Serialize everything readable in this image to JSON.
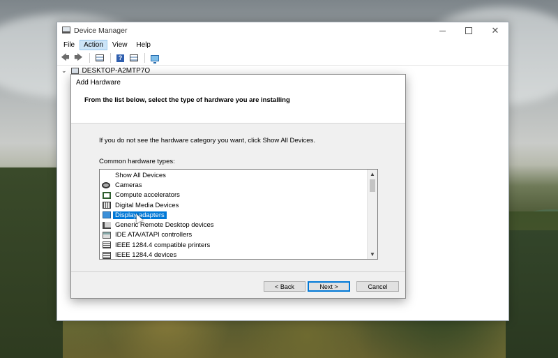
{
  "window": {
    "title": "Device Manager",
    "controls": {
      "minimize": "—",
      "maximize": "☐",
      "close": "✕"
    }
  },
  "menubar": {
    "items": [
      {
        "label": "File"
      },
      {
        "label": "Action",
        "active": true
      },
      {
        "label": "View"
      },
      {
        "label": "Help"
      }
    ]
  },
  "toolbar": {
    "buttons": [
      "back-arrow-icon",
      "forward-arrow-icon",
      "properties-icon",
      "help-icon",
      "grid-view-icon",
      "monitor-scan-icon"
    ]
  },
  "tree": {
    "root_label": "DESKTOP-A2MTP7O",
    "expand_glyph": "⌄"
  },
  "dialog": {
    "title": "Add Hardware",
    "heading": "From the list below, select the type of hardware you are installing",
    "info": "If you do not see the hardware category you want, click Show All Devices.",
    "list_label": "Common hardware types:",
    "items": [
      {
        "label": "Show All Devices",
        "icon": "blank"
      },
      {
        "label": "Cameras",
        "icon": "camera-icon"
      },
      {
        "label": "Compute accelerators",
        "icon": "chip-icon"
      },
      {
        "label": "Digital Media Devices",
        "icon": "media-device-icon"
      },
      {
        "label": "Display adapters",
        "icon": "display-adapter-icon",
        "selected": true
      },
      {
        "label": "Generic Remote Desktop devices",
        "icon": "remote-desktop-icon"
      },
      {
        "label": "IDE ATA/ATAPI controllers",
        "icon": "ide-controller-icon"
      },
      {
        "label": "IEEE 1284.4 compatible printers",
        "icon": "printer-icon"
      },
      {
        "label": "IEEE 1284.4 devices",
        "icon": "printer-icon"
      }
    ],
    "buttons": {
      "back": "< Back",
      "next": "Next >",
      "cancel": "Cancel"
    }
  },
  "colors": {
    "selection": "#0078d7",
    "menu_active": "#cce4f7"
  }
}
